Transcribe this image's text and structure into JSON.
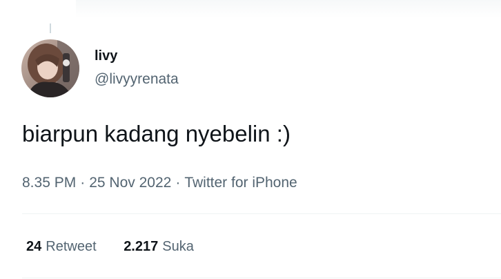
{
  "author": {
    "display_name": "livy",
    "handle": "@livyyrenata"
  },
  "tweet": {
    "text": "biarpun kadang nyebelin :)",
    "time": "8.35 PM",
    "date": "25 Nov 2022",
    "source": "Twitter for iPhone",
    "separator": "·"
  },
  "stats": {
    "retweets": {
      "count": "24",
      "label": "Retweet"
    },
    "likes": {
      "count": "2.217",
      "label": "Suka"
    }
  }
}
